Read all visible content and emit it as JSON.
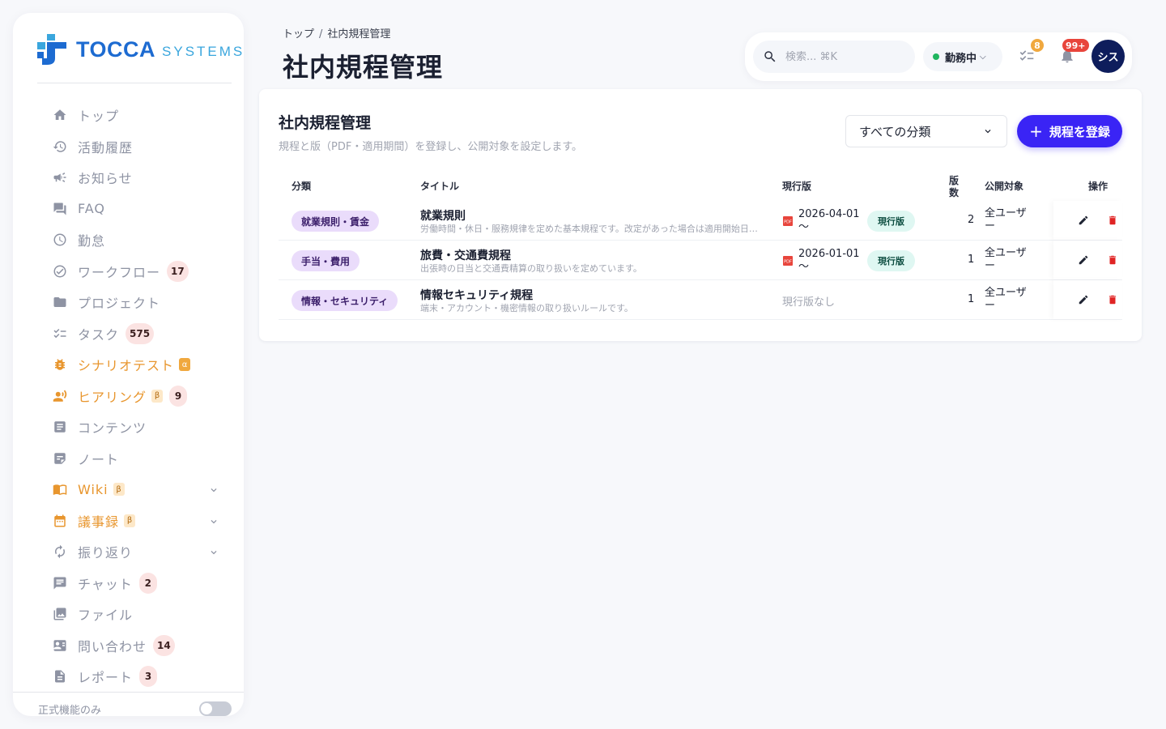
{
  "brand": {
    "name": "TOCCA",
    "sub": "SYSTEMS"
  },
  "sidebar": {
    "items": [
      {
        "label": "トップ",
        "icon": "home-icon"
      },
      {
        "label": "活動履歴",
        "icon": "history-icon"
      },
      {
        "label": "お知らせ",
        "icon": "megaphone-icon"
      },
      {
        "label": "FAQ",
        "icon": "forum-icon"
      },
      {
        "label": "勤怠",
        "icon": "clock-icon"
      },
      {
        "label": "ワークフロー",
        "icon": "check-circle-icon",
        "count": "17"
      },
      {
        "label": "プロジェクト",
        "icon": "folder-icon"
      },
      {
        "label": "タスク",
        "icon": "checklist-icon",
        "count": "575"
      },
      {
        "label": "シナリオテスト",
        "icon": "bug-icon",
        "tag": "α"
      },
      {
        "label": "ヒアリング",
        "icon": "interview-icon",
        "tag": "β",
        "count": "9"
      },
      {
        "label": "コンテンツ",
        "icon": "article-icon"
      },
      {
        "label": "ノート",
        "icon": "note-icon"
      },
      {
        "label": "Wiki",
        "icon": "book-icon",
        "tag": "β"
      },
      {
        "label": "議事録",
        "icon": "calendar-icon",
        "tag": "β"
      },
      {
        "label": "振り返り",
        "icon": "refresh-icon"
      },
      {
        "label": "チャット",
        "icon": "chat-icon",
        "count": "2"
      },
      {
        "label": "ファイル",
        "icon": "photo-library-icon"
      },
      {
        "label": "問い合わせ",
        "icon": "contact-card-icon",
        "count": "14"
      },
      {
        "label": "レポート",
        "icon": "report-icon",
        "count": "3"
      }
    ],
    "footer_label": "正式機能のみ"
  },
  "header": {
    "breadcrumb": [
      "トップ",
      "社内規程管理"
    ],
    "breadcrumb_sep": "/",
    "title": "社内規程管理",
    "search_placeholder": "検索... ⌘K",
    "status": "勤務中",
    "task_badge": "8",
    "notif_badge": "99+",
    "avatar": "シス"
  },
  "card": {
    "title": "社内規程管理",
    "subtitle": "規程と版（PDF・適用期間）を登録し、公開対象を設定します。",
    "filter_value": "すべての分類",
    "add_button": "規程を登録",
    "columns": {
      "category": "分類",
      "title": "タイトル",
      "current": "現行版",
      "versions_1": "版",
      "versions_2": "数",
      "target": "公開対象",
      "actions": "操作"
    },
    "rows": [
      {
        "category": "就業規則・賃金",
        "title": "就業規則",
        "desc": "労働時間・休日・服務規律を定めた基本規程です。改定があった場合は適用開始日を確認してください。",
        "date": "2026-04-01",
        "date_suffix": "〜",
        "current_badge": "現行版",
        "versions": "2",
        "target_1": "全ユーザ",
        "target_2": "ー"
      },
      {
        "category": "手当・費用",
        "title": "旅費・交通費規程",
        "desc": "出張時の日当と交通費精算の取り扱いを定めています。",
        "date": "2026-01-01",
        "date_suffix": "〜",
        "current_badge": "現行版",
        "versions": "1",
        "target_1": "全ユーザ",
        "target_2": "ー"
      },
      {
        "category": "情報・セキュリティ",
        "title": "情報セキュリティ規程",
        "desc": "端末・アカウント・機密情報の取り扱いルールです。",
        "none_text": "現行版なし",
        "versions": "1",
        "target_1": "全ユーザ",
        "target_2": "ー"
      }
    ]
  },
  "colors": {
    "primary": "#3a24f5",
    "accent_orange": "#e8962e",
    "category_tag": "#eadcfb",
    "current_badge": "#dff7f2",
    "status_green": "#1fb55f",
    "avatar_bg": "#0e1d5c",
    "delete_red": "#e02424"
  }
}
